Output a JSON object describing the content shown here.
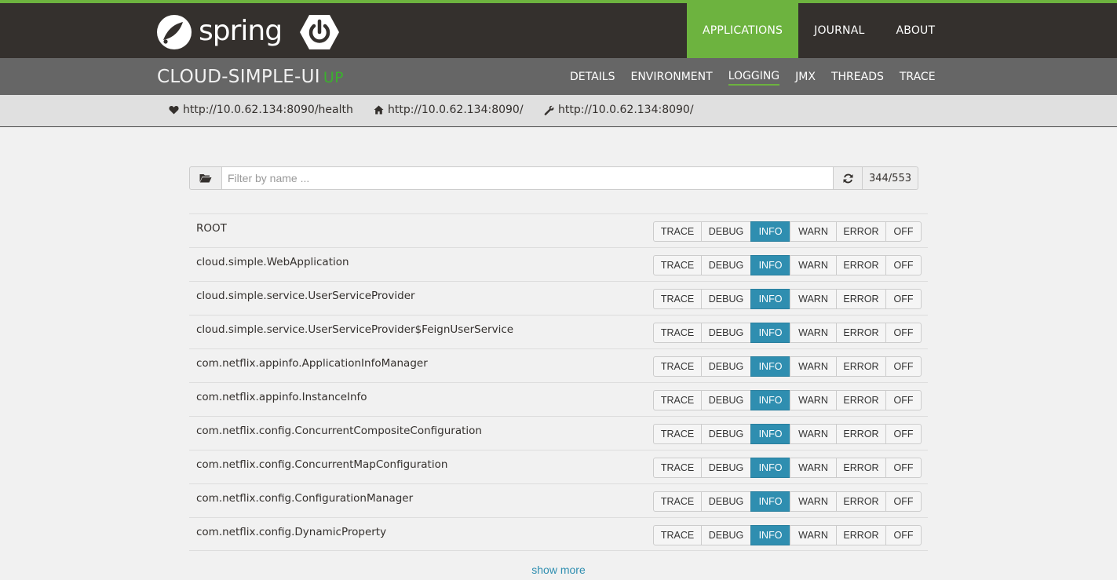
{
  "header": {
    "logo_text": "spring",
    "nav": [
      {
        "label": "APPLICATIONS",
        "active": true
      },
      {
        "label": "JOURNAL",
        "active": false
      },
      {
        "label": "ABOUT",
        "active": false
      }
    ]
  },
  "app": {
    "name": "CLOUD-SIMPLE-UI",
    "status": "UP",
    "tabs": [
      {
        "label": "DETAILS",
        "active": false
      },
      {
        "label": "ENVIRONMENT",
        "active": false
      },
      {
        "label": "LOGGING",
        "active": true
      },
      {
        "label": "JMX",
        "active": false
      },
      {
        "label": "THREADS",
        "active": false
      },
      {
        "label": "TRACE",
        "active": false
      }
    ]
  },
  "urls": {
    "health": "http://10.0.62.134:8090/health",
    "home": "http://10.0.62.134:8090/",
    "management": "http://10.0.62.134:8090/"
  },
  "filter": {
    "placeholder": "Filter by name ...",
    "count": "344/553"
  },
  "levels": [
    "TRACE",
    "DEBUG",
    "INFO",
    "WARN",
    "ERROR",
    "OFF"
  ],
  "loggers": [
    {
      "name": "ROOT",
      "level": "INFO"
    },
    {
      "name": "cloud.simple.WebApplication",
      "level": "INFO"
    },
    {
      "name": "cloud.simple.service.UserServiceProvider",
      "level": "INFO"
    },
    {
      "name": "cloud.simple.service.UserServiceProvider$FeignUserService",
      "level": "INFO"
    },
    {
      "name": "com.netflix.appinfo.ApplicationInfoManager",
      "level": "INFO"
    },
    {
      "name": "com.netflix.appinfo.InstanceInfo",
      "level": "INFO"
    },
    {
      "name": "com.netflix.config.ConcurrentCompositeConfiguration",
      "level": "INFO"
    },
    {
      "name": "com.netflix.config.ConcurrentMapConfiguration",
      "level": "INFO"
    },
    {
      "name": "com.netflix.config.ConfigurationManager",
      "level": "INFO"
    },
    {
      "name": "com.netflix.config.DynamicProperty",
      "level": "INFO"
    }
  ],
  "show_more": "show more",
  "colors": {
    "brand_green": "#6db33f",
    "header_dark": "#34302d",
    "status_up": "#3bb02e",
    "active_level": "#2f8eb0"
  }
}
